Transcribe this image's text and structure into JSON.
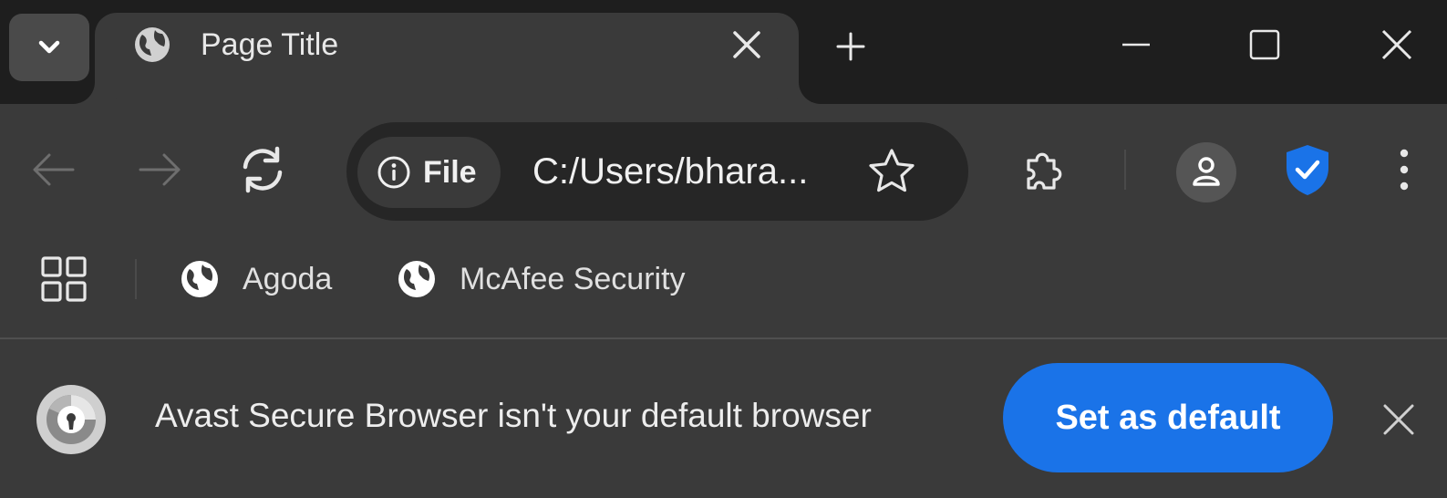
{
  "tab": {
    "title": "Page Title",
    "favicon": "globe-icon"
  },
  "tabstrip_icons": {
    "tab_search": "chevron-down-icon",
    "close_tab": "close-icon",
    "new_tab": "plus-icon",
    "minimize": "minimize-icon",
    "maximize": "maximize-icon",
    "close_window": "close-icon"
  },
  "toolbar": {
    "site_info_label": "File",
    "url": "C:/Users/bhara...",
    "icons": [
      "back-arrow-icon",
      "forward-arrow-icon",
      "reload-icon",
      "info-icon",
      "star-icon",
      "extensions-puzzle-icon",
      "profile-icon",
      "avast-shield-icon",
      "more-vertical-icon"
    ]
  },
  "bookmarks": {
    "items": [
      {
        "label": "Agoda",
        "icon": "globe-icon"
      },
      {
        "label": "McAfee Security",
        "icon": "globe-icon"
      }
    ]
  },
  "infobar": {
    "message": "Avast Secure Browser isn't your default browser",
    "button_label": "Set as default"
  },
  "colors": {
    "tabstrip_bg": "#1e1e1e",
    "toolbar_bg": "#3a3a3a",
    "omnibox_bg": "#262626",
    "accent_blue": "#1a73e8",
    "text": "#e8e8e8"
  }
}
